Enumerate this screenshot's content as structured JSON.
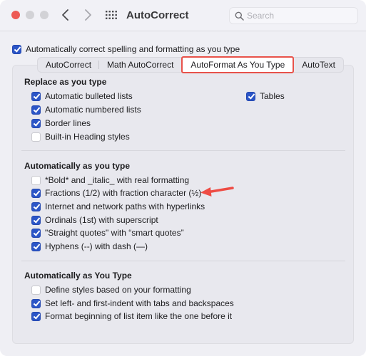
{
  "window": {
    "title": "AutoCorrect",
    "search_placeholder": "Search",
    "search_value": ""
  },
  "master_checkbox": {
    "label": "Automatically correct spelling and formatting as you type",
    "checked": true
  },
  "tabs": [
    {
      "label": "AutoCorrect",
      "active": false
    },
    {
      "label": "Math AutoCorrect",
      "active": false
    },
    {
      "label": "AutoFormat As You Type",
      "active": true,
      "highlighted": true
    },
    {
      "label": "AutoText",
      "active": false
    }
  ],
  "sections": [
    {
      "title": "Replace as you type",
      "items": [
        {
          "label": "Automatic bulleted lists",
          "checked": true
        },
        {
          "label": "Automatic numbered lists",
          "checked": true
        },
        {
          "label": "Border lines",
          "checked": true
        },
        {
          "label": "Built-in Heading styles",
          "checked": false
        },
        {
          "label": "Tables",
          "checked": true
        }
      ]
    },
    {
      "title": "Automatically as you type",
      "items": [
        {
          "label": "*Bold* and _italic_ with real formatting",
          "checked": false
        },
        {
          "label": "Fractions (1/2) with fraction character (½)",
          "checked": true,
          "annotated": true
        },
        {
          "label": "Internet and network paths with hyperlinks",
          "checked": true
        },
        {
          "label": "Ordinals (1st) with superscript",
          "checked": true
        },
        {
          "label": "\"Straight quotes\" with “smart quotes”",
          "checked": true
        },
        {
          "label": "Hyphens (--) with dash (—)",
          "checked": true
        }
      ]
    },
    {
      "title": "Automatically as You Type",
      "items": [
        {
          "label": "Define styles based on your formatting",
          "checked": false
        },
        {
          "label": "Set left- and first-indent with tabs and backspaces",
          "checked": true
        },
        {
          "label": "Format beginning of list item like the one before it",
          "checked": true
        }
      ]
    }
  ],
  "colors": {
    "accent": "#2b55c7",
    "highlight": "#e8524a",
    "close": "#ed5a55"
  }
}
